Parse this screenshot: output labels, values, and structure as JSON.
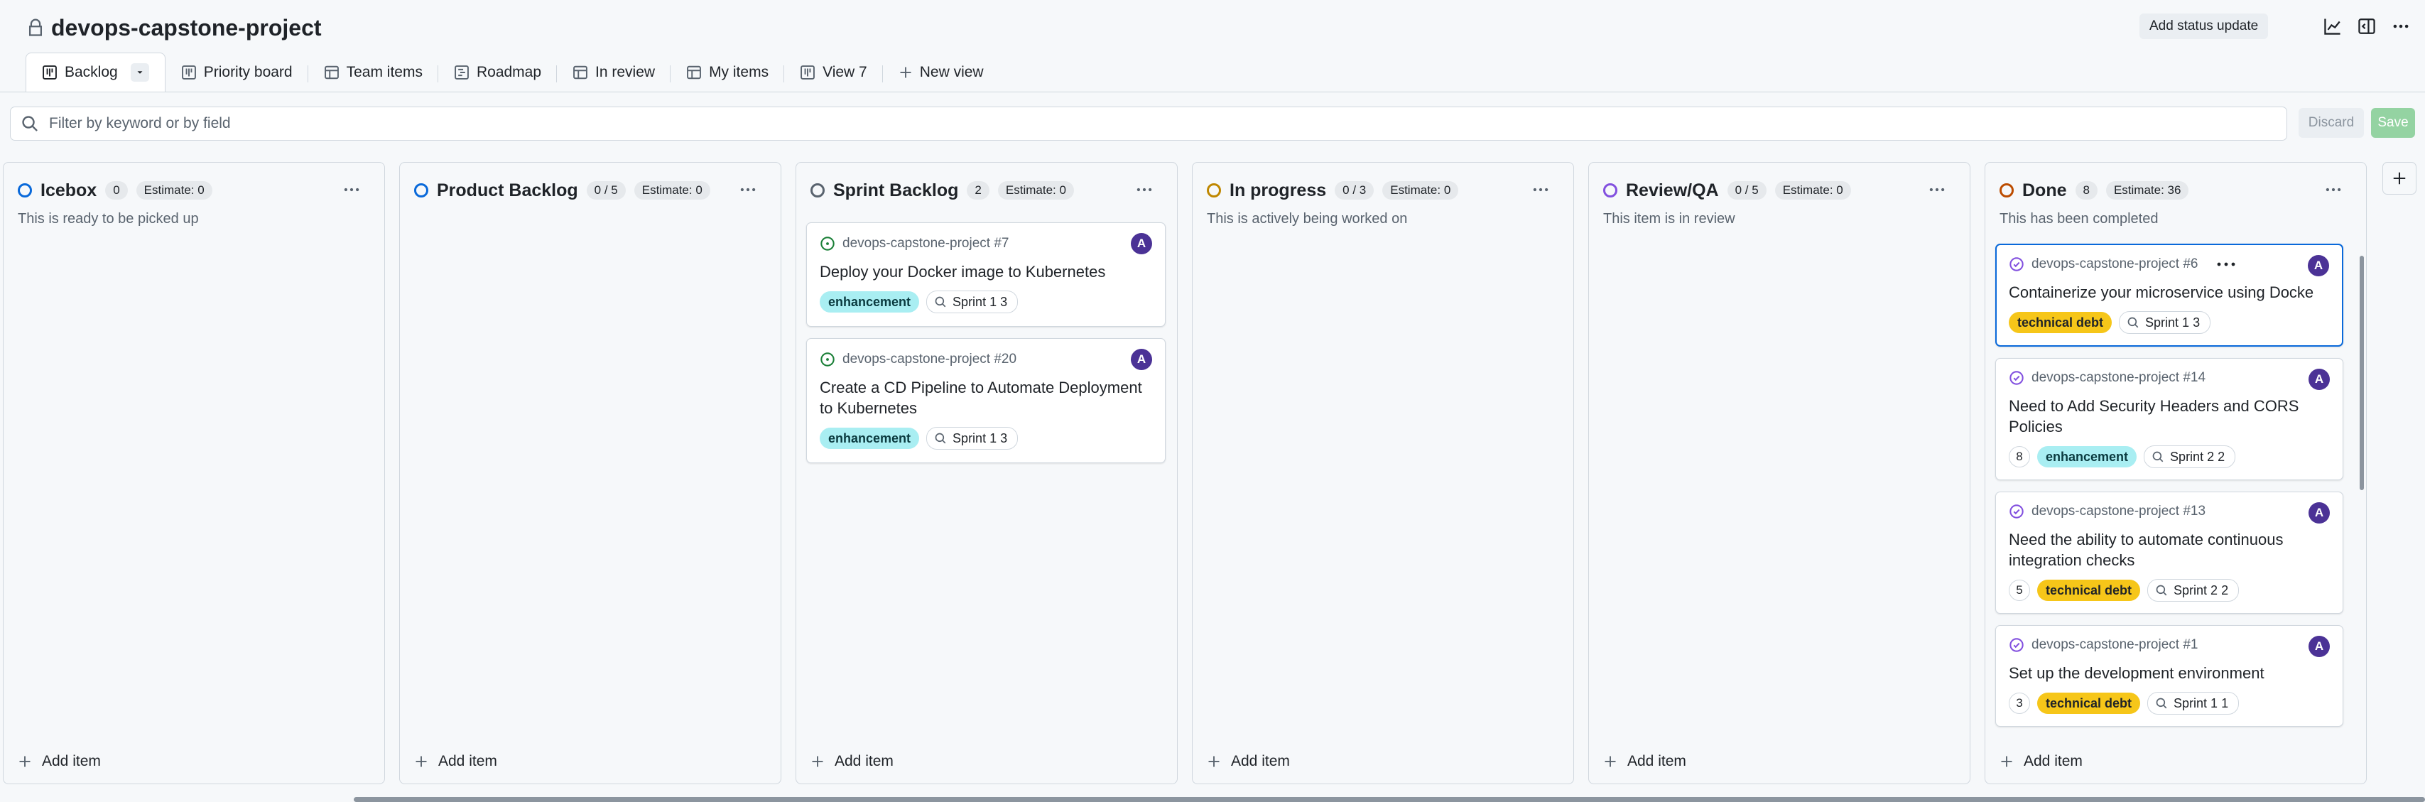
{
  "header": {
    "title": "devops-capstone-project",
    "status_update_label": "Add status update"
  },
  "tabs": [
    {
      "label": "Backlog",
      "icon": "board-icon",
      "active": true
    },
    {
      "label": "Priority board",
      "icon": "board-icon"
    },
    {
      "label": "Team items",
      "icon": "table-icon"
    },
    {
      "label": "Roadmap",
      "icon": "roadmap-icon"
    },
    {
      "label": "In review",
      "icon": "table-icon"
    },
    {
      "label": "My items",
      "icon": "table-icon"
    },
    {
      "label": "View 7",
      "icon": "board-icon"
    },
    {
      "label": "New view",
      "icon": "plus-icon"
    }
  ],
  "filter": {
    "placeholder": "Filter by keyword or by field"
  },
  "actions": {
    "discard_label": "Discard",
    "save_label": "Save"
  },
  "add_item_label": "Add item",
  "columns": [
    {
      "name": "Icebox",
      "count": "0",
      "estimate": "Estimate: 0",
      "description": "This is ready to be picked up",
      "color": "#0969da"
    },
    {
      "name": "Product Backlog",
      "count": "0 / 5",
      "estimate": "Estimate: 0",
      "description": "",
      "color": "#0969da"
    },
    {
      "name": "Sprint Backlog",
      "count": "2",
      "estimate": "Estimate: 0",
      "description": "",
      "color": "#59636e"
    },
    {
      "name": "In progress",
      "count": "0 / 3",
      "estimate": "Estimate: 0",
      "description": "This is actively being worked on",
      "color": "#bf8700"
    },
    {
      "name": "Review/QA",
      "count": "0 / 5",
      "estimate": "Estimate: 0",
      "description": "This item is in review",
      "color": "#8250df"
    },
    {
      "name": "Done",
      "count": "8",
      "estimate": "Estimate: 36",
      "description": "This has been completed",
      "color": "#bc4c00"
    }
  ],
  "sprint_backlog_cards": [
    {
      "ref": "devops-capstone-project #7",
      "title": "Deploy your Docker image to Kubernetes",
      "label": "enhancement",
      "sprint": "Sprint 1 3",
      "avatar": "A"
    },
    {
      "ref": "devops-capstone-project #20",
      "title": "Create a CD Pipeline to Automate Deployment to Kubernetes",
      "label": "enhancement",
      "sprint": "Sprint 1 3",
      "avatar": "A"
    }
  ],
  "done_cards": [
    {
      "ref": "devops-capstone-project #6",
      "title": "Containerize your microservice using Docke",
      "estimate": "",
      "label": "technical debt",
      "sprint": "Sprint 1 3",
      "avatar": "A"
    },
    {
      "ref": "devops-capstone-project #14",
      "title": "Need to Add Security Headers and CORS Policies",
      "estimate": "8",
      "label": "enhancement",
      "sprint": "Sprint 2 2",
      "avatar": "A"
    },
    {
      "ref": "devops-capstone-project #13",
      "title": "Need the ability to automate continuous integration checks",
      "estimate": "5",
      "label": "technical debt",
      "sprint": "Sprint 2 2",
      "avatar": "A"
    },
    {
      "ref": "devops-capstone-project #1",
      "title": "Set up the development environment",
      "estimate": "3",
      "label": "technical debt",
      "sprint": "Sprint 1 1",
      "avatar": "A"
    }
  ],
  "colors": {
    "accent": "#0969da",
    "enhancement_label": "#a9eef2",
    "technical_debt_label": "#f6c619",
    "avatar": "#4b3296",
    "open_issue": "#1a7f37",
    "closed_issue": "#8250df"
  }
}
